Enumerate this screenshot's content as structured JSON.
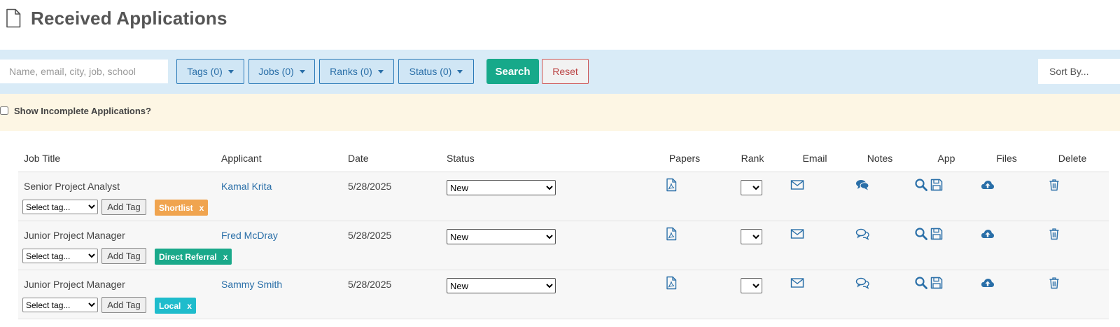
{
  "header": {
    "title": "Received Applications",
    "icon": "document-icon"
  },
  "filters": {
    "search_placeholder": "Name, email, city, job, school",
    "tags_label": "Tags (0)",
    "jobs_label": "Jobs (0)",
    "ranks_label": "Ranks (0)",
    "status_label": "Status (0)",
    "search_label": "Search",
    "reset_label": "Reset",
    "sort_label": "Sort By..."
  },
  "incomplete": {
    "label": "Show Incomplete Applications?"
  },
  "columns": {
    "job_title": "Job Title",
    "applicant": "Applicant",
    "date": "Date",
    "status": "Status",
    "papers": "Papers",
    "rank": "Rank",
    "email": "Email",
    "notes": "Notes",
    "app": "App",
    "files": "Files",
    "delete": "Delete"
  },
  "rows": [
    {
      "job_title": "Senior Project Analyst",
      "applicant": "Kamal Krita",
      "date": "5/28/2025",
      "status": "New",
      "tag_select": "Select tag...",
      "add_tag": "Add Tag",
      "tag": {
        "label": "Shortlist",
        "remove": "x",
        "color": "#f0a44f"
      },
      "notes_icon": "comments-filled-icon"
    },
    {
      "job_title": "Junior Project Manager",
      "applicant": "Fred McDray",
      "date": "5/28/2025",
      "status": "New",
      "tag_select": "Select tag...",
      "add_tag": "Add Tag",
      "tag": {
        "label": "Direct Referral",
        "remove": "x",
        "color": "#1aa98a"
      },
      "notes_icon": "comments-outline-icon"
    },
    {
      "job_title": "Junior Project Manager",
      "applicant": "Sammy Smith",
      "date": "5/28/2025",
      "status": "New",
      "tag_select": "Select tag...",
      "add_tag": "Add Tag",
      "tag": {
        "label": "Local",
        "remove": "x",
        "color": "#1fbccc"
      },
      "notes_icon": "comments-outline-icon"
    }
  ],
  "colors": {
    "accent": "#2a6fa8",
    "filter_bar": "#d9ebf7",
    "incomplete_bar": "#fdf6e4",
    "search_button": "#17a98a",
    "reset_border": "#cc5555"
  }
}
